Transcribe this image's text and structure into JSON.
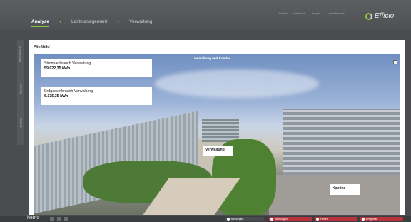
{
  "topnav": {
    "tabs": [
      "Analyse",
      "Lastmanagement",
      "Verwaltung"
    ]
  },
  "toplinks": [
    "Ansicht",
    "Handbuch",
    "Support",
    "Admin Benutzer"
  ],
  "brand": {
    "name": "Efficio",
    "accent": "#8dc63f"
  },
  "sidebar": {
    "tabs": [
      "Informationen",
      "Übersicht",
      "Berichte"
    ]
  },
  "panel": {
    "title": "Fließbild"
  },
  "photo": {
    "caption": "Verwaltung und Kantine",
    "stromverbrauch": {
      "label": "Stromverbrauch Verwaltung",
      "value": "59.922,35 kWh"
    },
    "erdgasverbrauch": {
      "label": "Erdgasverbrauch Verwaltung",
      "value": "6.135,35 kWh"
    },
    "tag_verwaltung": "Verwaltung",
    "tag_kantine": "Kantine"
  },
  "bottombar": {
    "brand": "hemo",
    "chips": [
      {
        "label": "Meldungen",
        "color": "#4a4c4f"
      },
      {
        "label": "Warnungen",
        "color": "#b8323d"
      },
      {
        "label": "Fehler",
        "color": "#b8323d"
      },
      {
        "label": "Ereignisse",
        "color": "#b8323d"
      }
    ]
  }
}
